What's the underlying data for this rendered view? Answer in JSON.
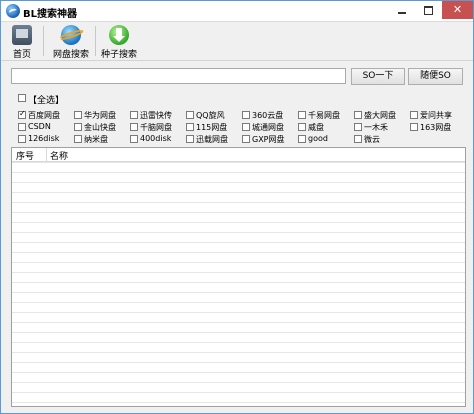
{
  "window": {
    "title": "BL搜索神器"
  },
  "title_buttons": {
    "minimize": "",
    "maximize": "",
    "close": "✕"
  },
  "toolbar": [
    {
      "name": "home",
      "label": "首页",
      "icon": "home-icon"
    },
    {
      "name": "netdisk-search",
      "label": "网盘搜索",
      "icon": "globe-icon"
    },
    {
      "name": "seed-search",
      "label": "种子搜索",
      "icon": "download-icon"
    }
  ],
  "search": {
    "value": "",
    "placeholder": "",
    "so_label": "SO一下",
    "random_label": "随便SO"
  },
  "select_all": {
    "label": "【全选】",
    "checked": false
  },
  "sources": [
    {
      "label": "百度网盘",
      "checked": true
    },
    {
      "label": "华为网盘",
      "checked": false
    },
    {
      "label": "迅雷快传",
      "checked": false
    },
    {
      "label": "QQ旋风",
      "checked": false
    },
    {
      "label": "360云盘",
      "checked": false
    },
    {
      "label": "千易网盘",
      "checked": false
    },
    {
      "label": "盛大网盘",
      "checked": false
    },
    {
      "label": "爱问共享",
      "checked": false
    },
    {
      "label": "CSDN",
      "checked": false
    },
    {
      "label": "金山快盘",
      "checked": false
    },
    {
      "label": "千脑网盘",
      "checked": false
    },
    {
      "label": "115网盘",
      "checked": false
    },
    {
      "label": "城通网盘",
      "checked": false
    },
    {
      "label": "威盘",
      "checked": false
    },
    {
      "label": "一木禾",
      "checked": false
    },
    {
      "label": "163网盘",
      "checked": false
    },
    {
      "label": "126disk",
      "checked": false
    },
    {
      "label": "纳米盘",
      "checked": false
    },
    {
      "label": "400disk",
      "checked": false
    },
    {
      "label": "迅载网盘",
      "checked": false
    },
    {
      "label": "GXP网盘",
      "checked": false
    },
    {
      "label": "good",
      "checked": false
    },
    {
      "label": "微云",
      "checked": false
    }
  ],
  "results": {
    "columns": [
      "序号",
      "名称"
    ],
    "rows": []
  }
}
